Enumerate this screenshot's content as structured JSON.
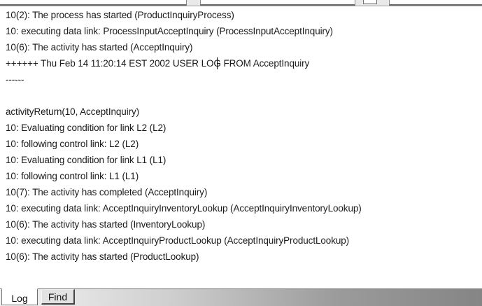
{
  "log": {
    "lines": [
      "10(2): The process has started (ProductInquiryProcess)",
      "10: executing data link: ProcessInputAcceptInquiry (ProcessInputAcceptInquiry)",
      "10(6): The activity has started (AcceptInquiry)",
      "++++++ Thu Feb 14 11:20:14 EST 2002 USER LOG FROM AcceptInquiry",
      "------",
      "",
      "activityReturn(10, AcceptInquiry)",
      "10: Evaluating condition for link L2 (L2)",
      "10: following control link: L2 (L2)",
      "10: Evaluating condition for link L1 (L1)",
      "10: following control link: L1 (L1)",
      "10(7): The activity has completed (AcceptInquiry)",
      "10: executing data link: AcceptInquiryInventoryLookup (AcceptInquiryInventoryLookup)",
      "10(6): The activity has started (InventoryLookup)",
      "10: executing data link: AcceptInquiryProductLookup (AcceptInquiryProductLookup)",
      "10(6): The activity has started (ProductLookup)"
    ]
  },
  "tabs": {
    "log_label": "Log",
    "find_label": "Find"
  }
}
